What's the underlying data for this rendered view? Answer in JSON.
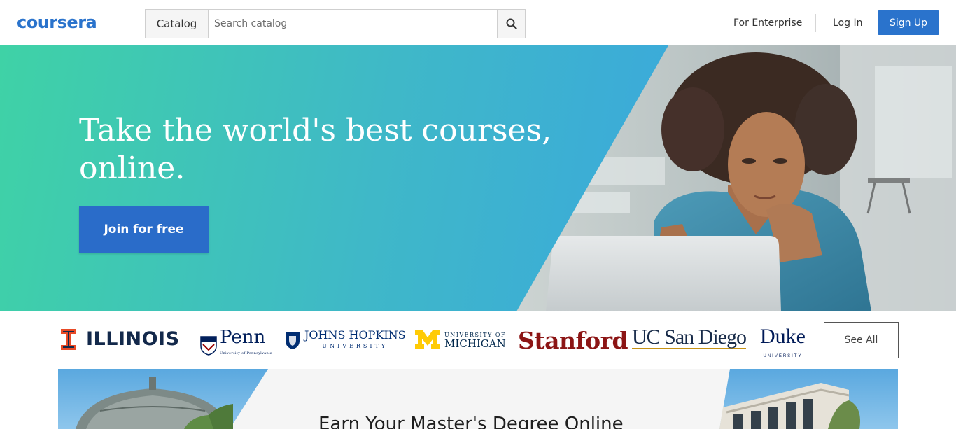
{
  "header": {
    "logo": "coursera",
    "catalog_label": "Catalog",
    "search_placeholder": "Search catalog",
    "search_value": "",
    "enterprise_label": "For Enterprise",
    "login_label": "Log In",
    "signup_label": "Sign Up",
    "search_icon": "search-icon"
  },
  "hero": {
    "title": "Take the world's best courses, online.",
    "cta_label": "Join for free"
  },
  "partners": {
    "logos": [
      {
        "name": "ILLINOIS"
      },
      {
        "name": "Penn",
        "sub": "University of Pennsylvania"
      },
      {
        "name": "JOHNS HOPKINS",
        "sub": "UNIVERSITY"
      },
      {
        "name": "MICHIGAN",
        "sub": "UNIVERSITY OF"
      },
      {
        "name": "Stanford"
      },
      {
        "name": "UC San Diego"
      },
      {
        "name": "Duke",
        "sub": "UNIVERSITY"
      }
    ],
    "see_all_label": "See All"
  },
  "masters": {
    "title": "Earn Your Master's Degree Online"
  },
  "colors": {
    "brand_blue": "#2a73cc",
    "hero_green": "#3fd2a6",
    "hero_blue": "#3aa2e0",
    "stanford_red": "#8c1515"
  }
}
